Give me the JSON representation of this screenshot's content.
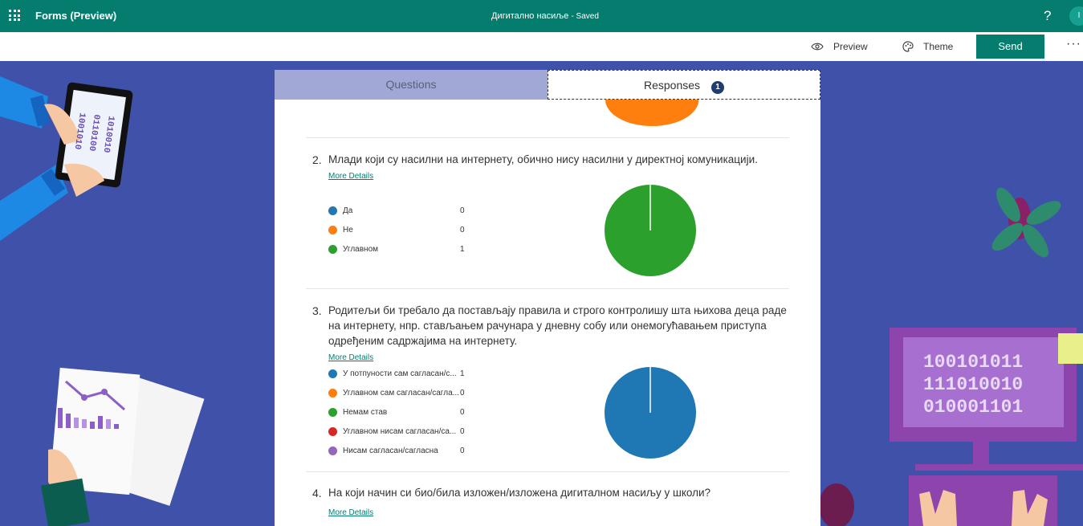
{
  "header": {
    "app_name": "Forms (Preview)",
    "doc_title": "Дигитално насиље",
    "doc_status": "- Saved",
    "help": "?",
    "avatar": "I"
  },
  "commands": {
    "preview": "Preview",
    "theme": "Theme",
    "send": "Send",
    "more": "···"
  },
  "tabs": {
    "questions": "Questions",
    "responses": "Responses",
    "responses_count": "1"
  },
  "colors": {
    "blue": "#1f77b4",
    "orange": "#ff7f0e",
    "green": "#2ca02c",
    "red": "#d62728",
    "purple": "#9467bd"
  },
  "questions": [
    {
      "number": "2.",
      "text": "Млади који су насилни на интернету, обично нису насилни у директној комуникацији.",
      "details": "More Details",
      "options": [
        {
          "label": "Да",
          "count": "0",
          "color": "#1f77b4"
        },
        {
          "label": "Не",
          "count": "0",
          "color": "#ff7f0e"
        },
        {
          "label": "Углавном",
          "count": "1",
          "color": "#2ca02c"
        }
      ]
    },
    {
      "number": "3.",
      "text_lines": [
        "Родитељи би требало да постављају правила и строго контролишу шта њихова деца раде",
        "на интернету, нпр. стављањем рачунара у дневну собу или онемогућавањем приступа",
        "одређеним садржајима на интернету."
      ],
      "details": "More Details",
      "options": [
        {
          "label": "У потпуности сам сагласан/с...",
          "count": "1",
          "color": "#1f77b4"
        },
        {
          "label": "Углавном сам сагласан/сагла...",
          "count": "0",
          "color": "#ff7f0e"
        },
        {
          "label": "Немам став",
          "count": "0",
          "color": "#2ca02c"
        },
        {
          "label": "Углавном нисам сагласан/са...",
          "count": "0",
          "color": "#d62728"
        },
        {
          "label": "Нисам сагласан/сагласна",
          "count": "0",
          "color": "#9467bd"
        }
      ]
    },
    {
      "number": "4.",
      "text": "На који начин си био/била изложен/изложена дигиталном насиљу у школи?",
      "details": "More Details"
    }
  ],
  "chart_data": [
    {
      "type": "pie",
      "categories": [
        "Да",
        "Не",
        "Углавном"
      ],
      "values": [
        0,
        0,
        1
      ]
    },
    {
      "type": "pie",
      "categories": [
        "У потпуности сам сагласан/с...",
        "Углавном сам сагласан/сагла...",
        "Немам став",
        "Углавном нисам сагласан/са...",
        "Нисам сагласан/сагласна"
      ],
      "values": [
        1,
        0,
        0,
        0,
        0
      ]
    }
  ],
  "decor": {
    "binary_tablet": [
      "1001010",
      "0110100",
      "1010010"
    ],
    "binary_monitor": [
      "100101011",
      "111010010",
      "010001101"
    ]
  }
}
